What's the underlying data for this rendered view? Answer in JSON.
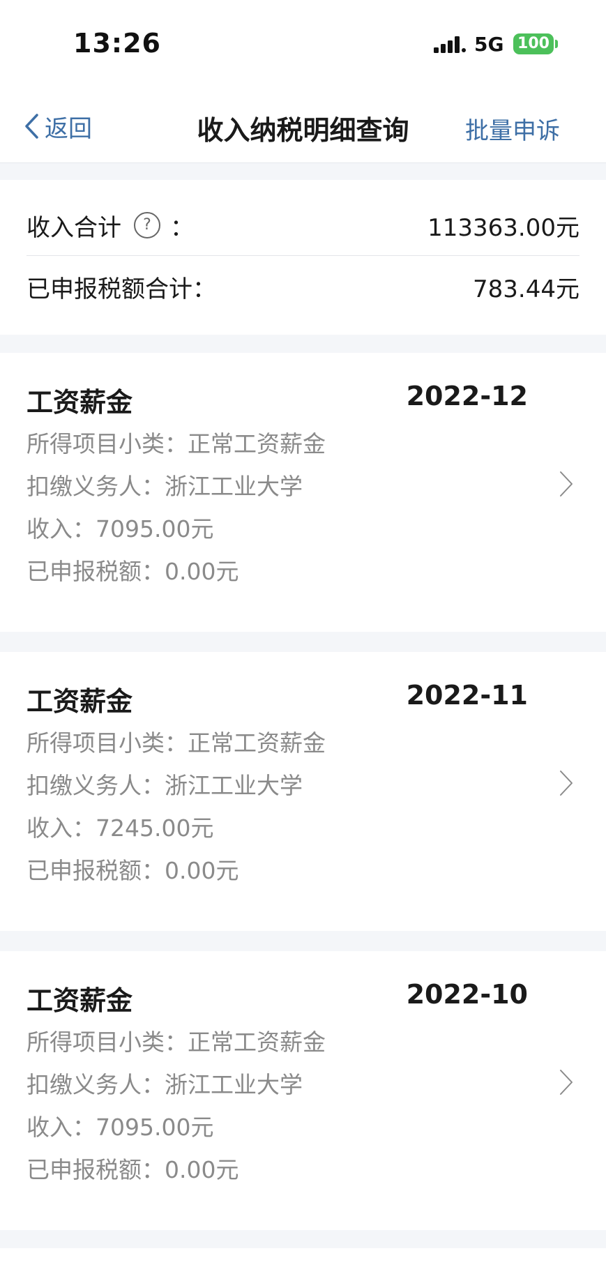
{
  "status_bar": {
    "time": "13:26",
    "network": "5G",
    "battery": "100"
  },
  "nav": {
    "back_label": "返回",
    "title": "收入纳税明细查询",
    "action_label": "批量申诉"
  },
  "summary": {
    "income_label": "收入合计",
    "income_colon": "：",
    "income_value": "113363.00元",
    "tax_label": "已申报税额合计：",
    "tax_value": "783.44元"
  },
  "records": [
    {
      "title": "工资薪金",
      "date": "2022-12",
      "subcategory": "所得项目小类：正常工资薪金",
      "withholder": "扣缴义务人：浙江工业大学",
      "income": "收入：7095.00元",
      "tax": "已申报税额：0.00元"
    },
    {
      "title": "工资薪金",
      "date": "2022-11",
      "subcategory": "所得项目小类：正常工资薪金",
      "withholder": "扣缴义务人：浙江工业大学",
      "income": "收入：7245.00元",
      "tax": "已申报税额：0.00元"
    },
    {
      "title": "工资薪金",
      "date": "2022-10",
      "subcategory": "所得项目小类：正常工资薪金",
      "withholder": "扣缴义务人：浙江工业大学",
      "income": "收入：7095.00元",
      "tax": "已申报税额：0.00元"
    }
  ],
  "icons": {
    "back": "chevron-left-icon",
    "help": "question-circle-icon",
    "row_arrow": "chevron-right-icon",
    "signal": "signal-bars-icon",
    "battery": "battery-icon"
  },
  "colors": {
    "accent": "#3e6fa6",
    "secondary_text": "#8a8a8a",
    "battery_green": "#4cc05a",
    "page_background": "#f4f6f9"
  }
}
